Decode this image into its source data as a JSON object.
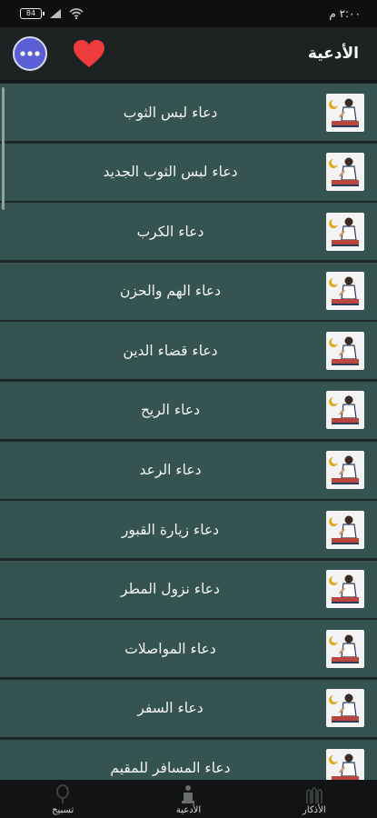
{
  "status_bar": {
    "time": "٢:٠٠ م",
    "battery": "84"
  },
  "header": {
    "title": "الأدعية"
  },
  "list": {
    "items": [
      {
        "label": "دعاء لبس الثوب"
      },
      {
        "label": "دعاء لبس الثوب الجديد"
      },
      {
        "label": "دعاء الكرب"
      },
      {
        "label": "دعاء الهم والحزن"
      },
      {
        "label": "دعاء قضاء الدين"
      },
      {
        "label": "دعاء الريح"
      },
      {
        "label": "دعاء الرعد"
      },
      {
        "label": "دعاء زيارة القبور"
      },
      {
        "label": "دعاء نزول المطر"
      },
      {
        "label": "دعاء المواصلات"
      },
      {
        "label": "دعاء السفر"
      },
      {
        "label": "دعاء المسافر للمقيم"
      }
    ]
  },
  "bottom_nav": {
    "tasbeeh": "تسبيح",
    "adiya": "الأدعية",
    "adhkar": "الأذكار"
  },
  "colors": {
    "row_bg": "#355351",
    "header_bg": "#1d2223",
    "heart": "#ef3b3b",
    "more_button": "#5a5fd6"
  },
  "icons": {
    "row": "praying-man-icon",
    "more": "more-options-icon",
    "favorite": "heart-icon"
  }
}
